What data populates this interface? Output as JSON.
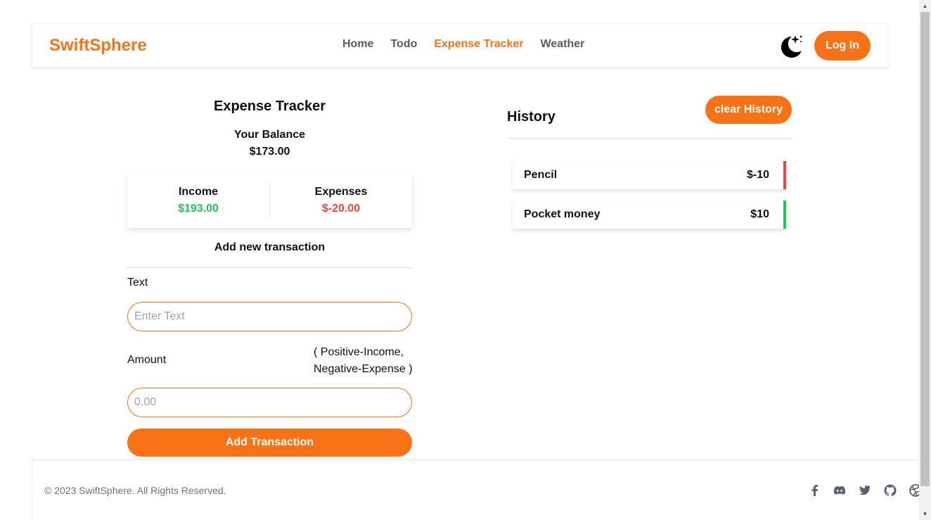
{
  "header": {
    "brand": "SwiftSphere",
    "nav": [
      "Home",
      "Todo",
      "Expense Tracker",
      "Weather"
    ],
    "active_nav": "Expense Tracker",
    "login_label": "Log In",
    "theme_icon": "moon-stars-icon"
  },
  "tracker": {
    "title": "Expense Tracker",
    "balance_label": "Your Balance",
    "balance": "$173.00",
    "income_label": "Income",
    "income": "$193.00",
    "expenses_label": "Expenses",
    "expenses": "$-20.00",
    "add_title": "Add new transaction",
    "text_label": "Text",
    "text_placeholder": "Enter Text",
    "amount_label": "Amount",
    "amount_hint_line1": "( Positive-Income,",
    "amount_hint_line2": "Negative-Expense )",
    "amount_placeholder": "0.00",
    "add_button": "Add Transaction"
  },
  "history": {
    "title": "History",
    "clear_button": "clear History",
    "items": [
      {
        "text": "Pencil",
        "amount": "$-10",
        "kind": "expense"
      },
      {
        "text": "Pocket money",
        "amount": "$10",
        "kind": "income"
      }
    ]
  },
  "footer": {
    "copyright": "© 2023 SwiftSphere. All Rights Reserved.",
    "social_icons": [
      "facebook-icon",
      "discord-icon",
      "twitter-icon",
      "github-icon",
      "dribbble-icon"
    ]
  },
  "colors": {
    "accent": "#f97316",
    "income": "#22c55e",
    "expense": "#ef4444",
    "nav_text": "#555a64"
  }
}
